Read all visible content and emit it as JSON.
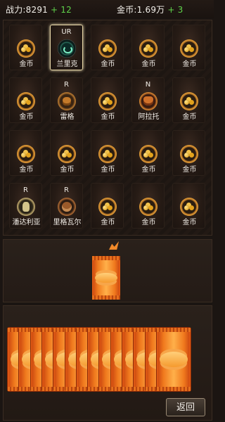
{
  "stats": {
    "power_label": "战力:",
    "power_value": "8291",
    "power_gain": "+ 12",
    "gold_label": "金币:",
    "gold_value": "1.69万",
    "gold_gain": "+ 3"
  },
  "cards": [
    {
      "tier": "",
      "name": "金币",
      "icon": "coin-icon"
    },
    {
      "tier": "UR",
      "name": "兰里克",
      "icon": "ring-icon"
    },
    {
      "tier": "",
      "name": "金币",
      "icon": "coin-icon"
    },
    {
      "tier": "",
      "name": "金币",
      "icon": "coin-icon"
    },
    {
      "tier": "",
      "name": "金币",
      "icon": "coin-icon"
    },
    {
      "tier": "",
      "name": "金币",
      "icon": "coin-icon"
    },
    {
      "tier": "R",
      "name": "雷格",
      "icon": "brown-creature-icon"
    },
    {
      "tier": "",
      "name": "金币",
      "icon": "coin-icon"
    },
    {
      "tier": "N",
      "name": "阿拉托",
      "icon": "demon-face-icon"
    },
    {
      "tier": "",
      "name": "金币",
      "icon": "coin-icon"
    },
    {
      "tier": "",
      "name": "金币",
      "icon": "coin-icon"
    },
    {
      "tier": "",
      "name": "金币",
      "icon": "coin-icon"
    },
    {
      "tier": "",
      "name": "金币",
      "icon": "coin-icon"
    },
    {
      "tier": "",
      "name": "金币",
      "icon": "coin-icon"
    },
    {
      "tier": "",
      "name": "金币",
      "icon": "coin-icon"
    },
    {
      "tier": "R",
      "name": "潘达利亚",
      "icon": "skull-knight-icon"
    },
    {
      "tier": "R",
      "name": "里格瓦尔",
      "icon": "ape-icon"
    },
    {
      "tier": "",
      "name": "金币",
      "icon": "coin-icon"
    },
    {
      "tier": "",
      "name": "金币",
      "icon": "coin-icon"
    },
    {
      "tier": "",
      "name": "金币",
      "icon": "coin-icon"
    }
  ],
  "selected_card_name": "兰里克",
  "colors": {
    "gain": "#5fd24a",
    "pack": "#f07a1e",
    "selection": "#e8d7a8"
  },
  "back_button": {
    "label": "返回"
  }
}
